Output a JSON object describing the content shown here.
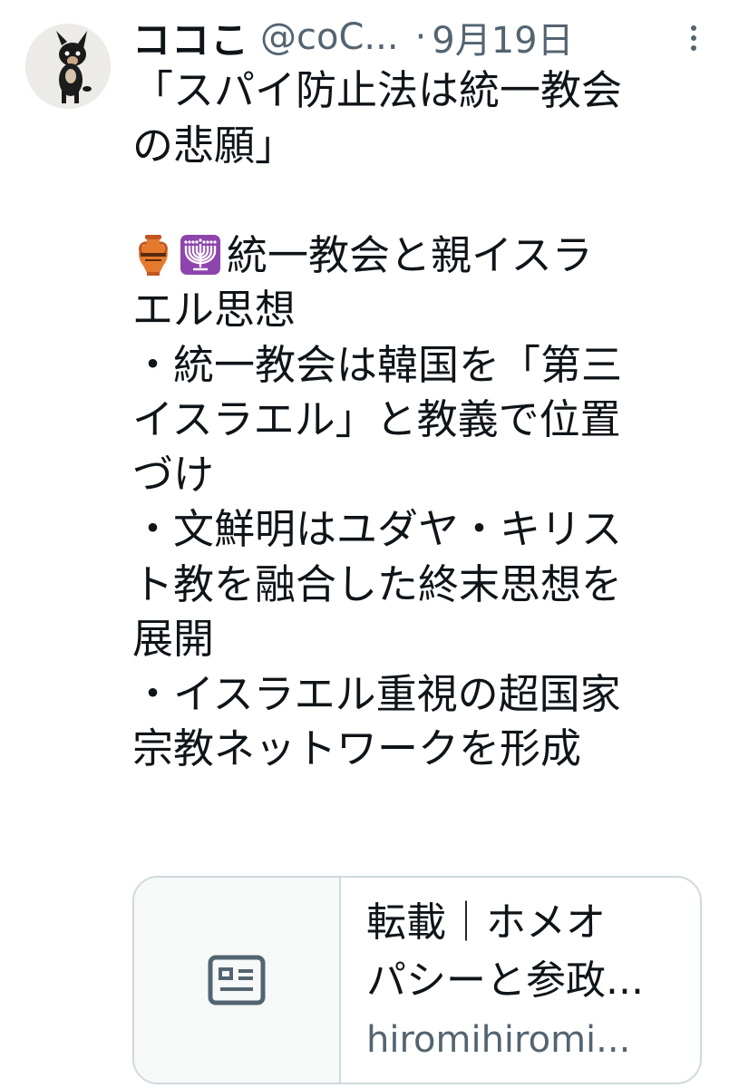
{
  "tweet": {
    "author_name": "ココこ",
    "author_handle": "@coC...",
    "separator": "·",
    "date": "9月19日",
    "text_lines": [
      "「スパイ防止法は統一教会",
      "の悲願」",
      "",
      "統一教会と親イスラ",
      "エル思想",
      "・統一教会は韓国を「第三",
      "イスラエル」と教義で位置",
      "づけ",
      "・文鮮明はユダヤ・キリス",
      "ト教を融合した終末思想を",
      "展開",
      "・イスラエル重視の超国家",
      "宗教ネットワークを形成"
    ],
    "emojis": [
      "amphora-emoji",
      "menorah-emoji"
    ]
  },
  "link_card": {
    "title_line1": "転載｜ホメオ",
    "title_line2": "パシーと参政...",
    "domain": "hiromihiromi..."
  },
  "icons": {
    "more": "more-options-icon",
    "card_thumb": "article-icon"
  },
  "colors": {
    "text": "#0f1419",
    "muted": "#536471",
    "border": "#cfd9de",
    "menorah_bg": "#8e44ad",
    "amphora": "#e57a2e"
  }
}
